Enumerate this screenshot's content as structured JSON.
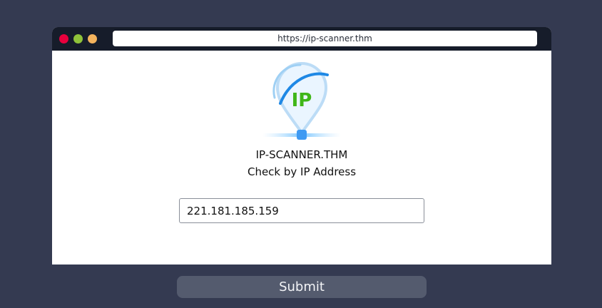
{
  "window": {
    "url": "https://ip-scanner.thm",
    "controls": [
      "close",
      "minimize",
      "maximize"
    ]
  },
  "logo": {
    "icon": "ip-location-pin-icon",
    "text": "IP"
  },
  "site": {
    "name": "IP-SCANNER.THM",
    "subtitle": "Check by IP Address"
  },
  "form": {
    "ip_value": "221.181.185.159",
    "submit_label": "Submit"
  },
  "colors": {
    "background": "#343a51",
    "titlebar": "#161c2a",
    "close": "#e8003d",
    "minimize": "#8fc23a",
    "maximize": "#f4b35d",
    "logo_text": "#3fb618",
    "logo_blue": "#1e88e5",
    "submit_bg": "#545b6e"
  }
}
